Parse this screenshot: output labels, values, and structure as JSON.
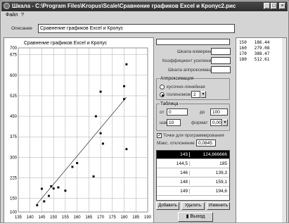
{
  "window": {
    "title": "Шкала - C:\\Program Files\\Kropus\\Scale\\Сравнение графиков Excel и Кропус2.рис",
    "min_glyph": "_",
    "max_glyph": "□",
    "close_glyph": "×"
  },
  "menu": {
    "file": "Файл",
    "help": "?"
  },
  "description": {
    "label": "Описание",
    "value": "Сравнение графиков Excel и Кропус"
  },
  "chart_data": {
    "type": "scatter",
    "title": "Сравнение графиков Excel и Кропус",
    "xlim": [
      135,
      190
    ],
    "ylim": [
      100,
      700
    ],
    "xticks": [
      135,
      140,
      145,
      150,
      155,
      160,
      165,
      170,
      175,
      180,
      185,
      190
    ],
    "yticks": [
      100,
      150,
      225,
      300,
      375,
      450,
      525,
      600,
      675,
      700
    ],
    "grid": true,
    "points": [
      {
        "x": 143,
        "y": 125
      },
      {
        "x": 145,
        "y": 185
      },
      {
        "x": 146,
        "y": 139
      },
      {
        "x": 148,
        "y": 159
      },
      {
        "x": 149,
        "y": 194
      },
      {
        "x": 150,
        "y": 186
      },
      {
        "x": 152,
        "y": 190
      },
      {
        "x": 155,
        "y": 178
      },
      {
        "x": 158,
        "y": 265
      },
      {
        "x": 160,
        "y": 279
      },
      {
        "x": 167,
        "y": 230
      },
      {
        "x": 168,
        "y": 450
      },
      {
        "x": 170,
        "y": 388
      },
      {
        "x": 170,
        "y": 540
      },
      {
        "x": 171,
        "y": 350
      },
      {
        "x": 180,
        "y": 513
      },
      {
        "x": 180,
        "y": 560
      },
      {
        "x": 181,
        "y": 640
      },
      {
        "x": 181,
        "y": 330
      }
    ],
    "line": [
      {
        "x": 143,
        "y": 130
      },
      {
        "x": 181,
        "y": 520
      }
    ]
  },
  "panel": {
    "scale_label": "Шкала измерения",
    "coef_label": "Коэффициент усиления",
    "approx_scale_label": "Шкала аппроксимации",
    "approx": {
      "legend": "Аппроксимация",
      "option_piecewise": "кусочно-линейная",
      "option_poly": "полиномом",
      "poly_degree": "2"
    },
    "table": {
      "legend": "Таблица",
      "from_label": "от",
      "from_value": "0",
      "to_label": "до",
      "to_value": "100",
      "step_label": "шаг",
      "step_value": "10",
      "format_label": "формат",
      "format_value": "0,00"
    },
    "points_check_label": "Точки для программирования",
    "max_dev_label": "Макс. отклонение",
    "max_dev_value": "0,0845",
    "grid_rows": [
      {
        "c1": "143",
        "c2": "124,666666"
      },
      {
        "c1": "144,5",
        "c2": "185"
      },
      {
        "c1": "146",
        "c2": "139,3"
      },
      {
        "c1": "148",
        "c2": "159,1"
      },
      {
        "c1": "149",
        "c2": "194,6"
      }
    ],
    "add_button": "Добавить",
    "delete_button": "Удалить",
    "edit_button": "Изменить"
  },
  "exit_button": "Выход",
  "list_items": [
    "150   186.44",
    "160   279.08",
    "170   388.47",
    "180   512.61"
  ]
}
